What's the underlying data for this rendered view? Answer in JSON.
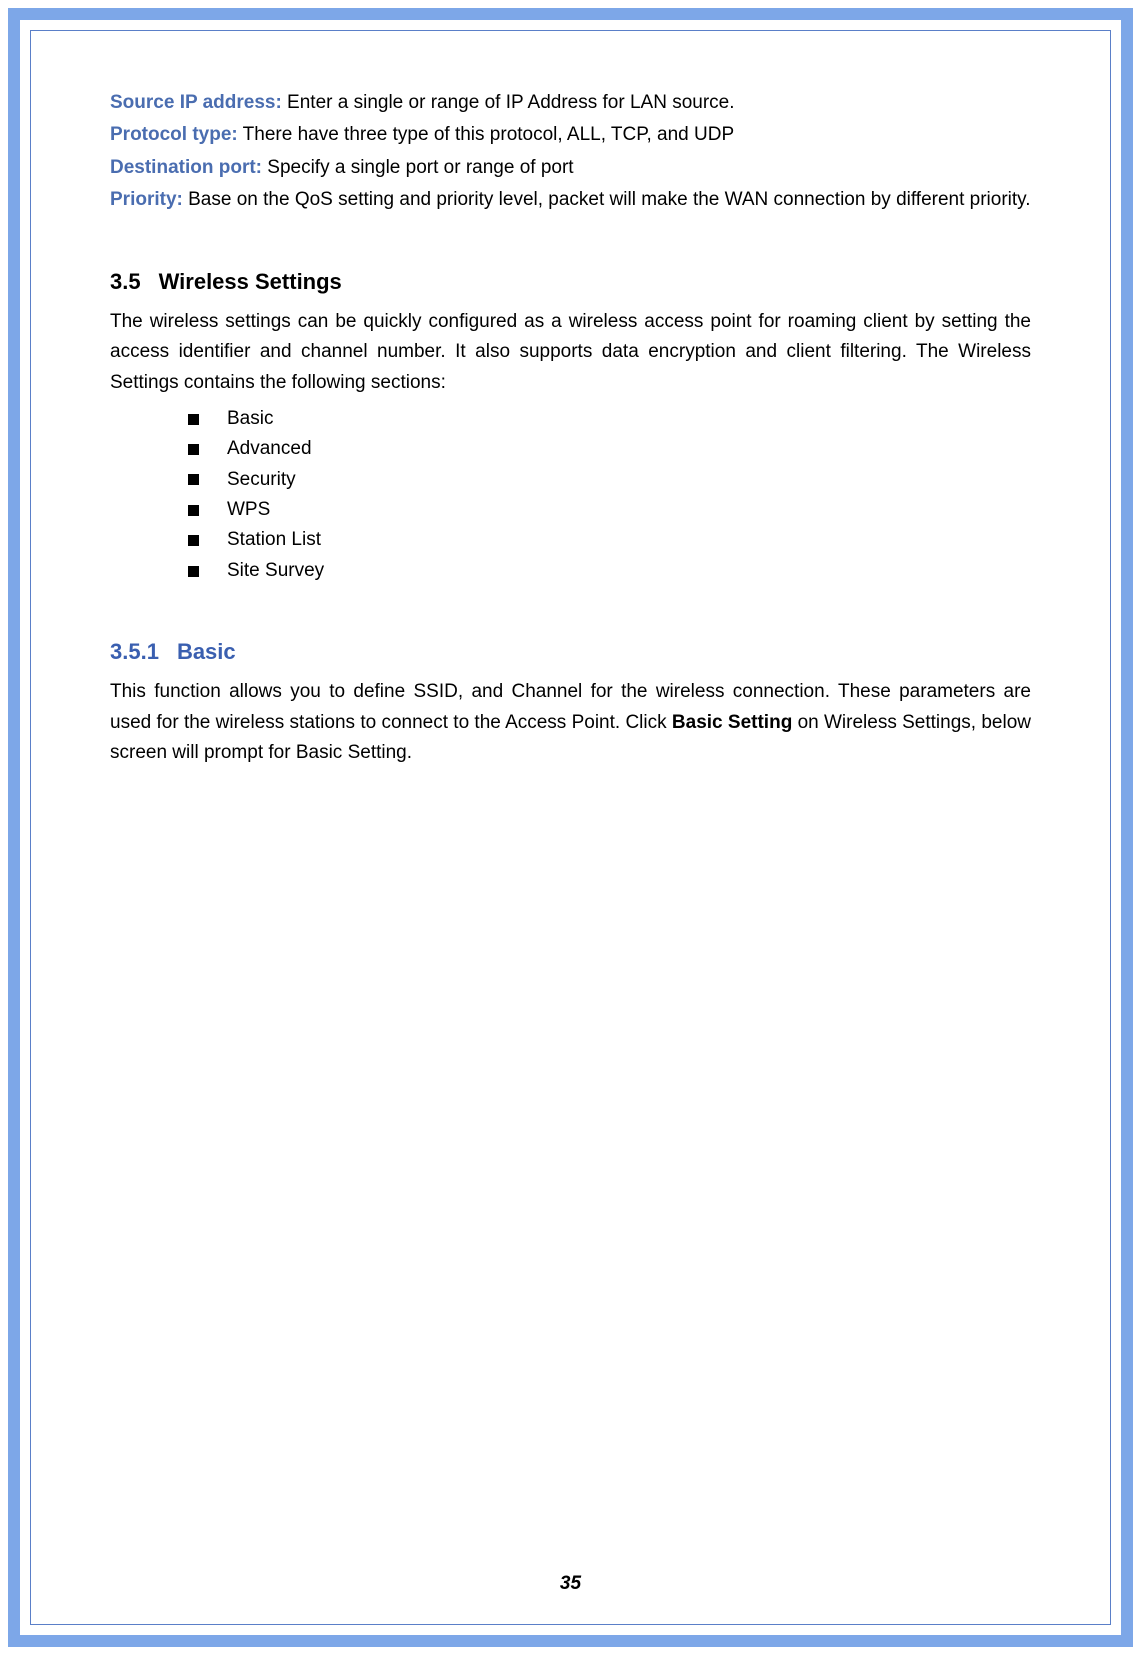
{
  "definitions": {
    "source_ip": {
      "label": "Source IP address:",
      "text": " Enter a single or range of IP Address for LAN source."
    },
    "protocol_type": {
      "label": "Protocol type:",
      "text": " There have three type of this protocol, ALL, TCP, and UDP"
    },
    "destination_port": {
      "label": "Destination port:",
      "text": " Specify a single port or range of port"
    },
    "priority": {
      "label": "Priority:",
      "text": " Base on the QoS setting and priority level, packet will make the WAN connection by different priority."
    }
  },
  "section_3_5": {
    "number": "3.5",
    "title": "Wireless Settings",
    "intro": "The wireless settings can be quickly configured as a wireless access point for roaming client by setting the access identifier and channel number. It also supports data encryption and client filtering. The Wireless Settings contains the following sections:",
    "items": [
      "Basic",
      "Advanced",
      "Security",
      "WPS",
      "Station List",
      "Site Survey"
    ]
  },
  "section_3_5_1": {
    "number": "3.5.1",
    "title": "Basic",
    "text_before_bold": "This function allows you to define SSID, and Channel for the wireless connection. These parameters are used for the wireless stations to connect to the Access Point. Click ",
    "bold": "Basic Setting",
    "text_after_bold": " on Wireless Settings, below screen will prompt for Basic Setting."
  },
  "page_number": "35"
}
